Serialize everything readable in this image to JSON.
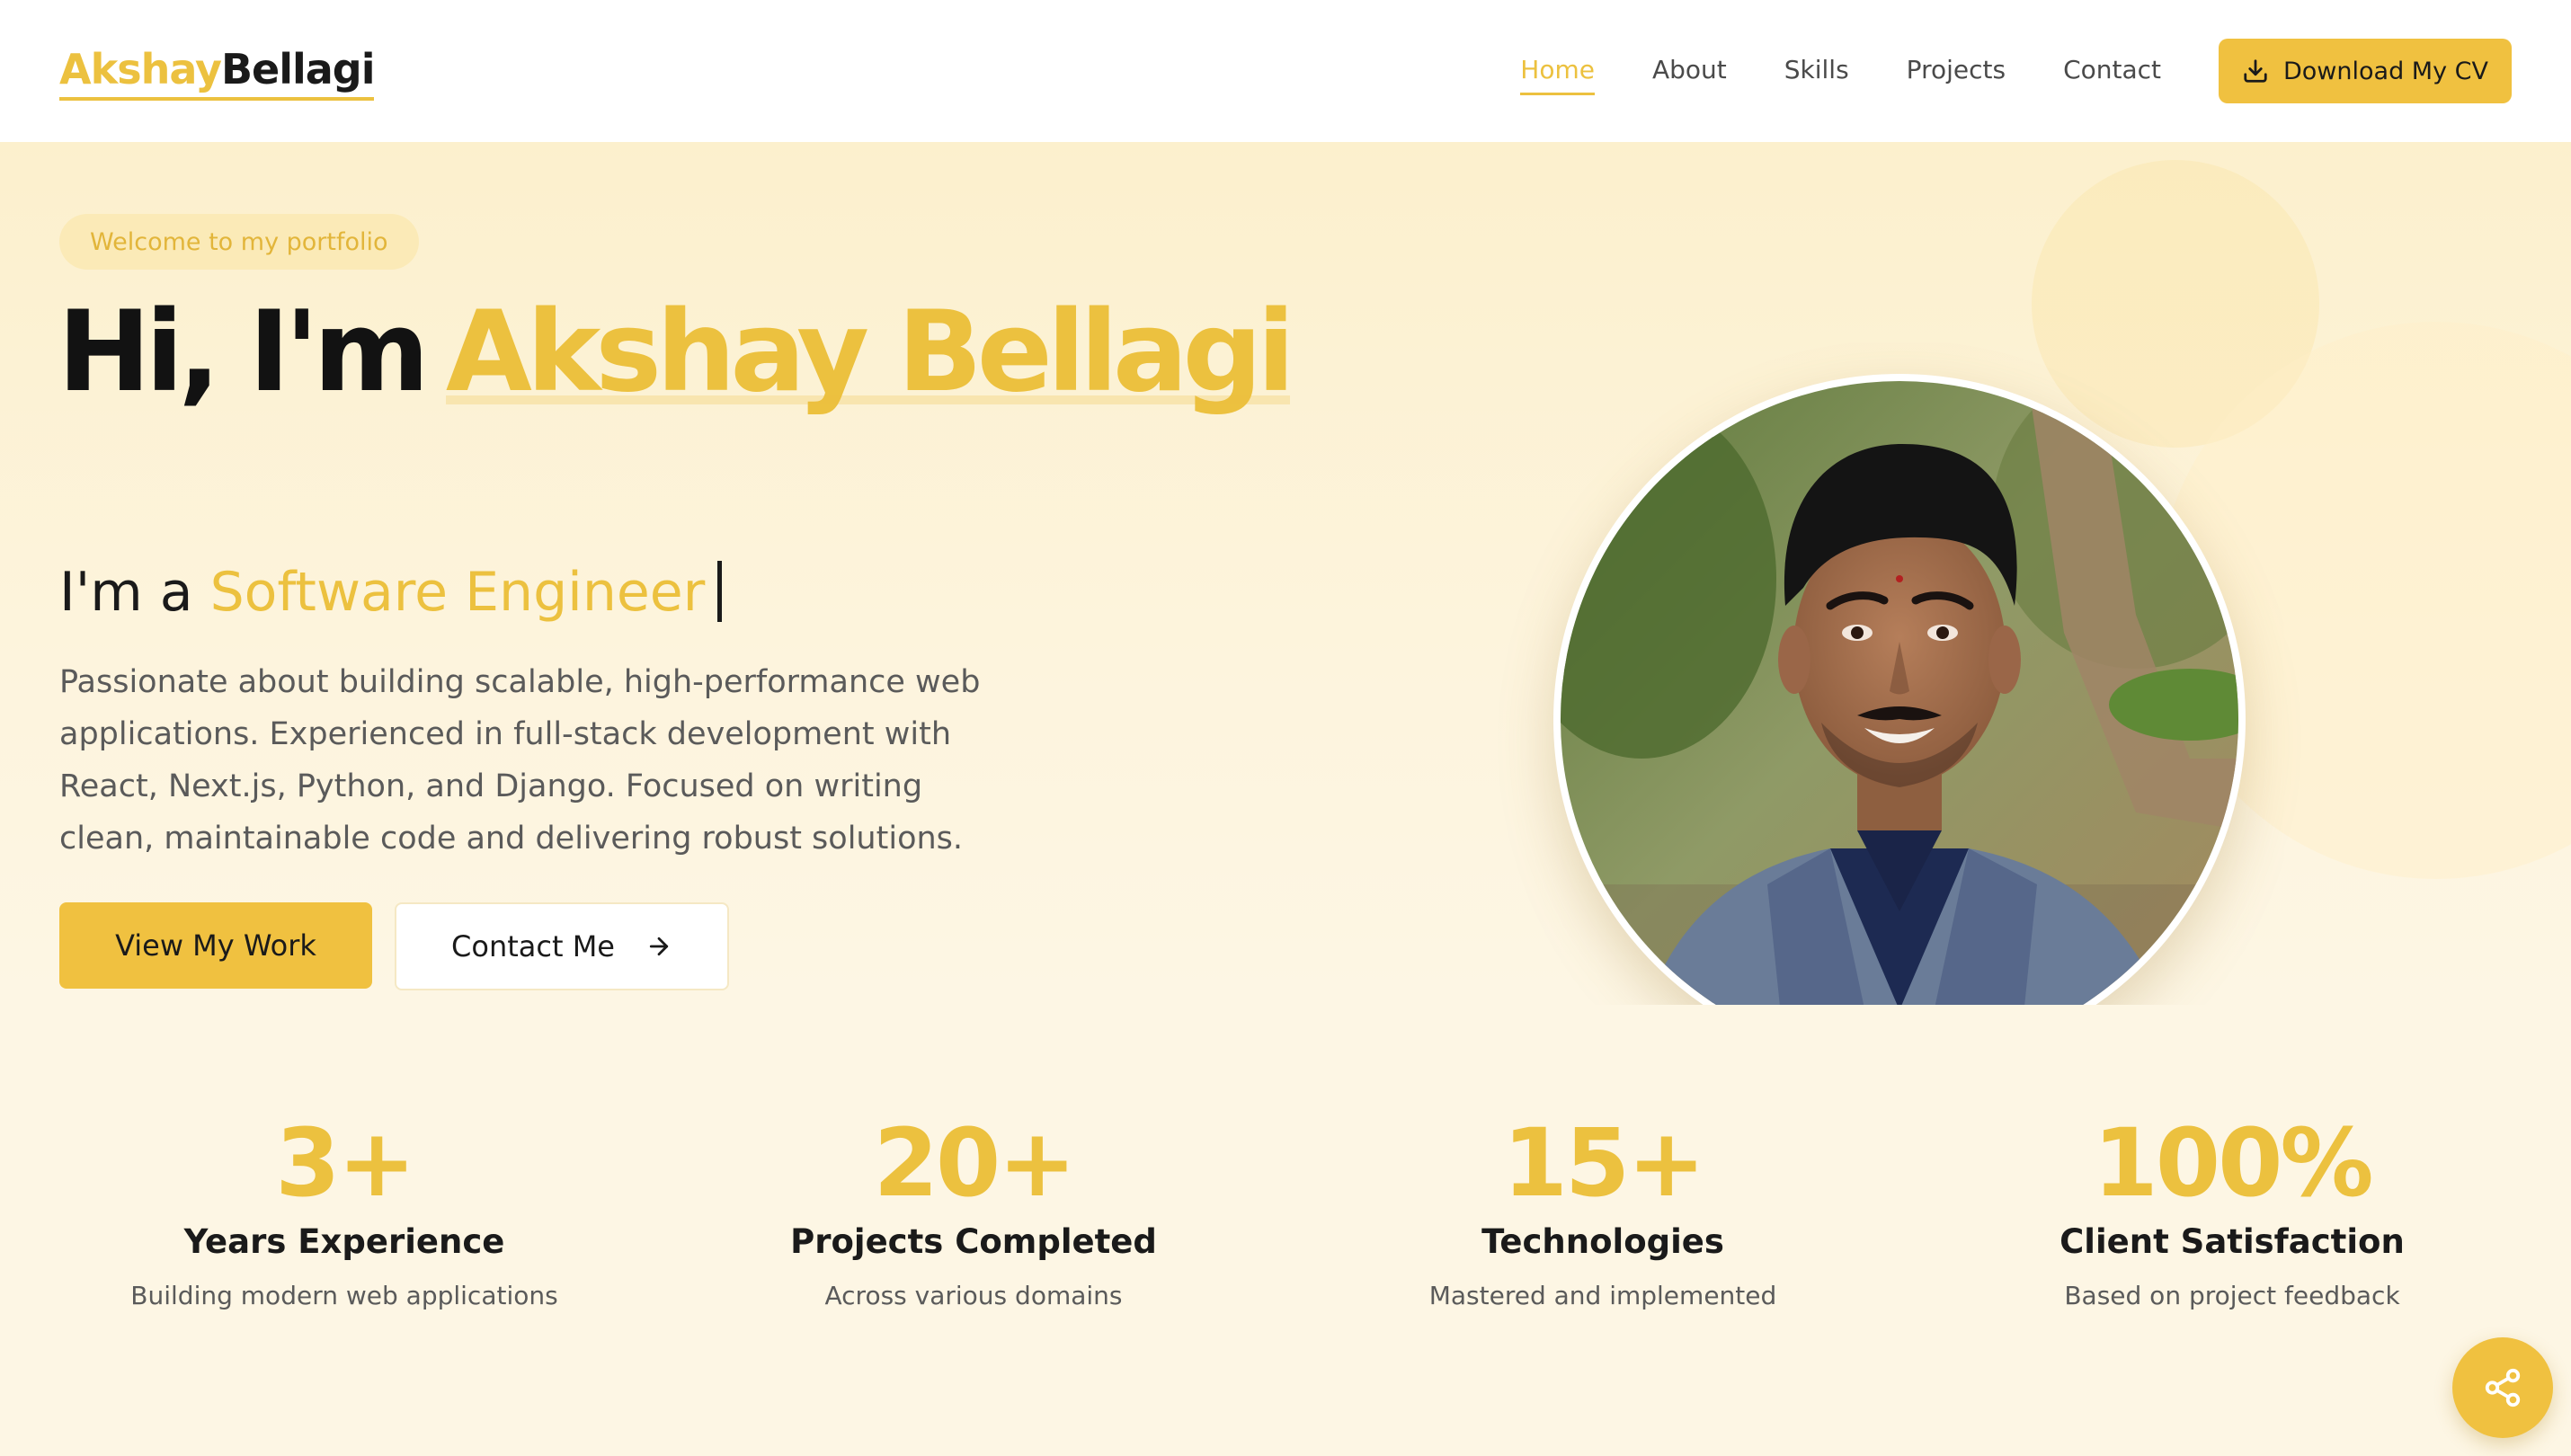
{
  "header": {
    "logo_first": "Akshay",
    "logo_last": "Bellagi",
    "nav": [
      "Home",
      "About",
      "Skills",
      "Projects",
      "Contact"
    ],
    "active_nav": "Home",
    "cv_button": "Download My CV"
  },
  "hero": {
    "badge": "Welcome to my portfolio",
    "greeting": "Hi, I'm",
    "name": "Akshay Bellagi",
    "subtitle_prefix": "I'm a",
    "role": "Software Engineer",
    "description": "Passionate about building scalable, high-performance web applications. Experienced in full-stack development with React, Next.js, Python, and Django. Focused on writing clean, maintainable code and delivering robust solutions.",
    "primary_button": "View My Work",
    "secondary_button": "Contact Me",
    "socials": [
      "github-icon",
      "linkedin-icon",
      "twitter-icon",
      "instagram-icon"
    ]
  },
  "stats": [
    {
      "value": "3+",
      "label": "Years Experience",
      "desc": "Building modern web applications"
    },
    {
      "value": "20+",
      "label": "Projects Completed",
      "desc": "Across various domains"
    },
    {
      "value": "15+",
      "label": "Technologies",
      "desc": "Mastered and implemented"
    },
    {
      "value": "100%",
      "label": "Client Satisfaction",
      "desc": "Based on project feedback"
    }
  ],
  "colors": {
    "accent": "#ECC13F",
    "background": "#FDF6E4",
    "text": "#1A1A1A"
  },
  "fab": "share-icon"
}
